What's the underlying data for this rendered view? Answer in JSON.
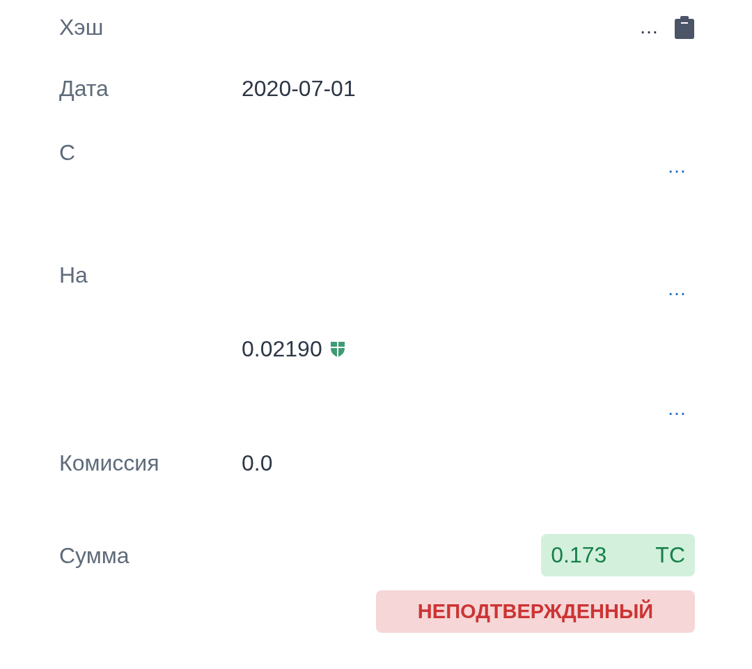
{
  "rows": [
    {
      "kind": "hash",
      "label": "Хэш",
      "value": "…",
      "copy": true
    },
    {
      "kind": "date",
      "label": "Дата",
      "value": "2020-07-01"
    },
    {
      "kind": "from",
      "label": "С",
      "lines": [
        {
          "kind": "link",
          "text": "…"
        }
      ]
    },
    {
      "kind": "to",
      "label": "На",
      "lines": [
        {
          "kind": "link",
          "text": "…"
        },
        {
          "kind": "amount",
          "text": "0.02190",
          "verified": true
        },
        {
          "kind": "link",
          "text": "…"
        }
      ]
    },
    {
      "kind": "fee",
      "label": "Комиссия",
      "lines": [
        {
          "kind": "amount",
          "text": "0.0"
        }
      ]
    },
    {
      "kind": "sum",
      "label": "Сумма",
      "amount": [
        "0.173",
        "TC"
      ],
      "status": {
        "kind": "unconfirmed",
        "label": "НЕПОДТВЕРЖДЕННЫЙ"
      }
    }
  ]
}
